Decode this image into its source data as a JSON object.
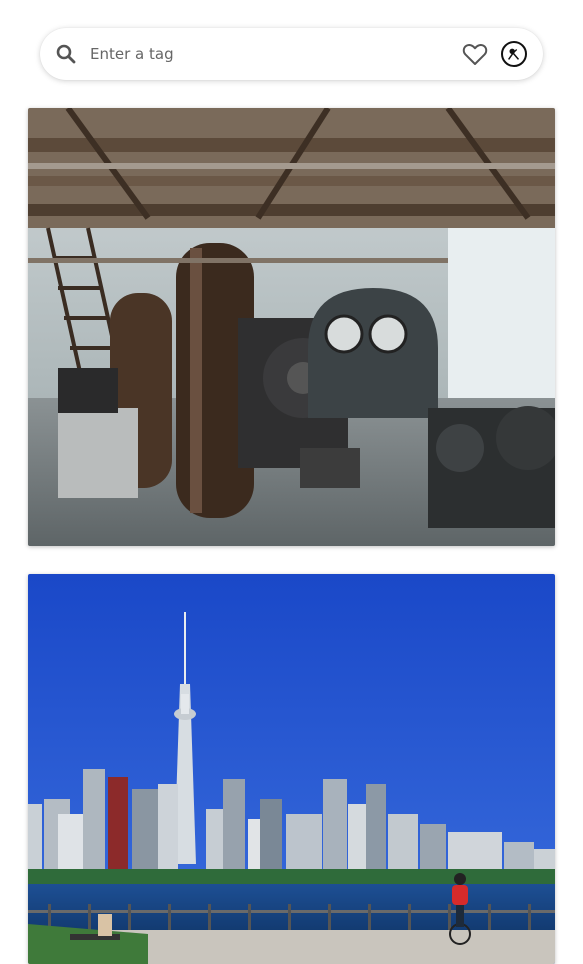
{
  "search": {
    "placeholder": "Enter a tag",
    "value": "",
    "icon": "search-icon"
  },
  "header_actions": {
    "favorites_icon": "heart-icon",
    "profile_icon": "avatar-icon"
  },
  "photos": [
    {
      "subject": "industrial-machinery-interior"
    },
    {
      "subject": "city-skyline-waterfront"
    }
  ],
  "colors": {
    "background": "#ffffff",
    "icon": "#555555",
    "sky_blue": "#1a4fbf"
  }
}
